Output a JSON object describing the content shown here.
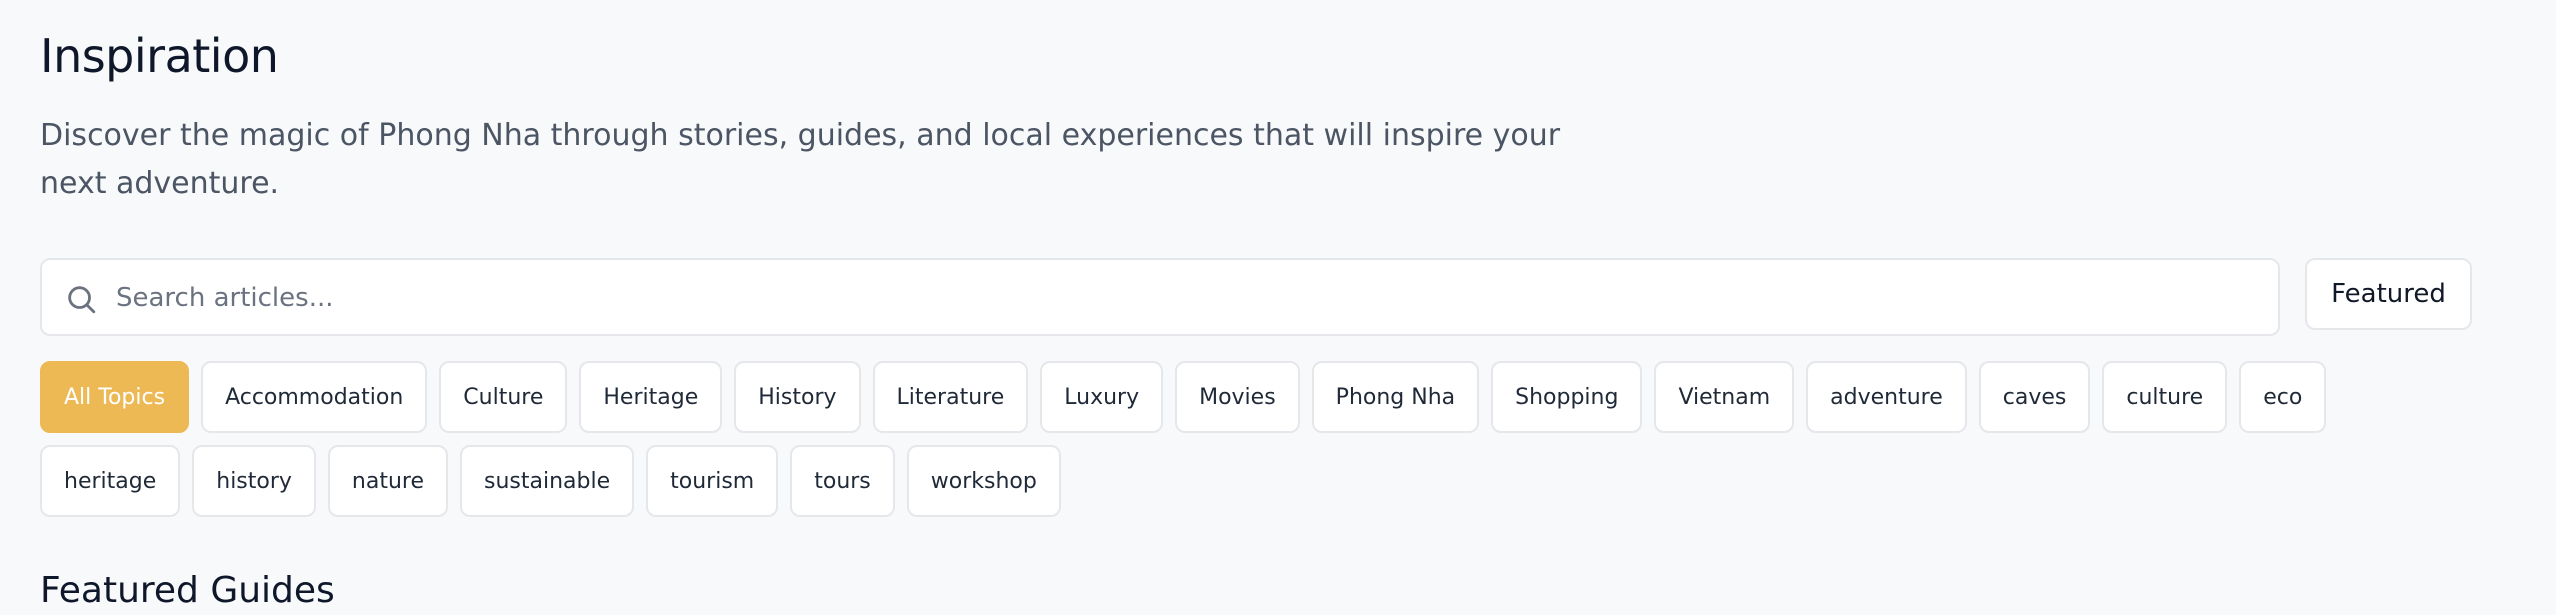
{
  "header": {
    "title": "Inspiration",
    "description": "Discover the magic of Phong Nha through stories, guides, and local experiences that will inspire your next adventure."
  },
  "search": {
    "placeholder": "Search articles...",
    "value": "",
    "icon": "search-icon"
  },
  "featured_button": {
    "label": "Featured"
  },
  "topics": {
    "active": "All Topics",
    "row1": [
      "All Topics",
      "Accommodation",
      "Culture",
      "Heritage",
      "History",
      "Literature",
      "Luxury",
      "Movies",
      "Phong Nha",
      "Shopping",
      "Vietnam",
      "adventure",
      "caves",
      "culture",
      "eco"
    ],
    "row2": [
      "heritage",
      "history",
      "nature",
      "sustainable",
      "tourism",
      "tours",
      "workshop"
    ]
  },
  "sections": {
    "featured_heading": "Featured Guides"
  },
  "colors": {
    "accent": "#ecb955",
    "background": "#f8f9fb",
    "border": "#e5e7eb",
    "text_muted": "#4b5563"
  }
}
